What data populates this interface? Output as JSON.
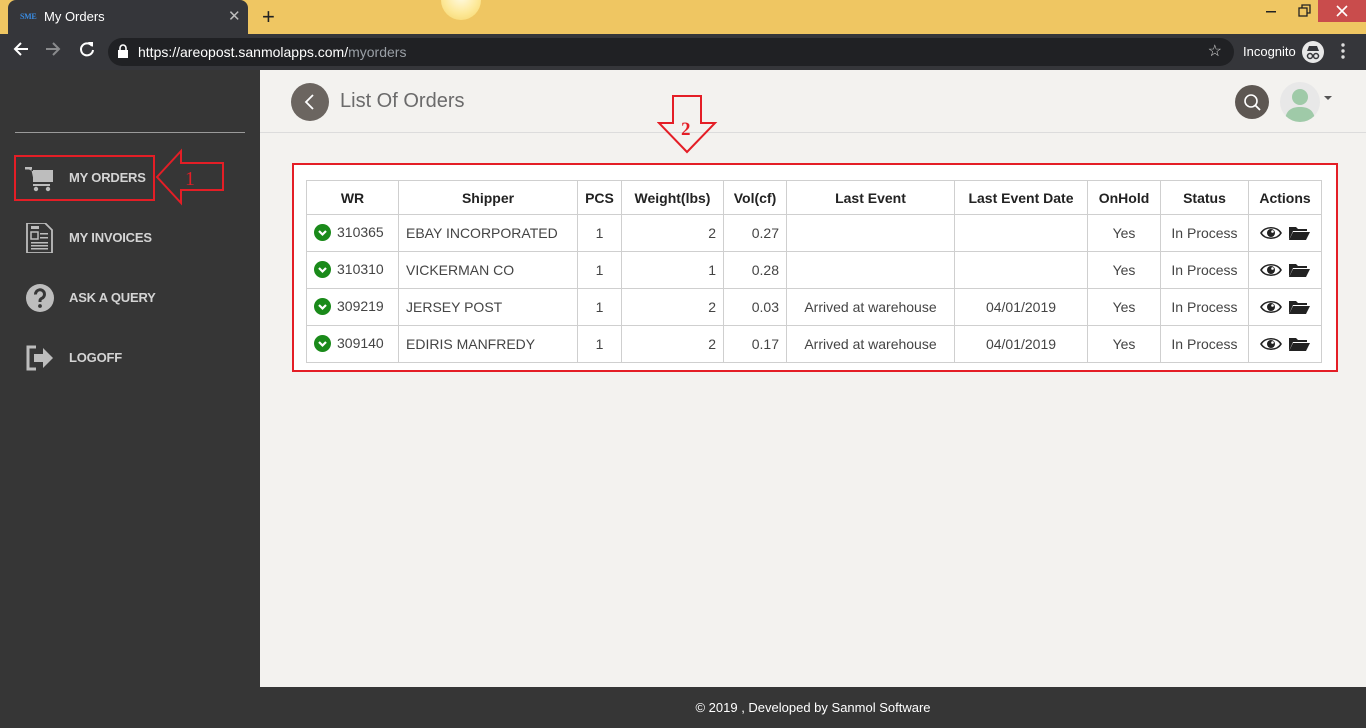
{
  "browser": {
    "tab": {
      "favicon_text": "SME",
      "title": "My Orders"
    },
    "url": {
      "host": "https://areopost.sanmolapps.com/",
      "path": "myorders"
    },
    "incognito_label": "Incognito"
  },
  "sidebar": {
    "items": [
      {
        "label": "MY ORDERS",
        "icon": "cart-icon",
        "active": true
      },
      {
        "label": "MY INVOICES",
        "icon": "invoice-icon"
      },
      {
        "label": "ASK A QUERY",
        "icon": "question-icon"
      },
      {
        "label": "LOGOFF",
        "icon": "logoff-icon"
      }
    ]
  },
  "annotations": {
    "arrow1_label": "1",
    "arrow2_label": "2",
    "color": "#e41e26"
  },
  "header": {
    "title": "List Of Orders"
  },
  "orders": {
    "columns": [
      "WR",
      "Shipper",
      "PCS",
      "Weight(lbs)",
      "Vol(cf)",
      "Last Event",
      "Last Event Date",
      "OnHold",
      "Status",
      "Actions"
    ],
    "rows": [
      {
        "wr": "310365",
        "shipper": "EBAY INCORPORATED",
        "pcs": "1",
        "weight": "2",
        "vol": "0.27",
        "last_event": "",
        "last_event_date": "",
        "onhold": "Yes",
        "status": "In Process"
      },
      {
        "wr": "310310",
        "shipper": "VICKERMAN CO",
        "pcs": "1",
        "weight": "1",
        "vol": "0.28",
        "last_event": "",
        "last_event_date": "",
        "onhold": "Yes",
        "status": "In Process"
      },
      {
        "wr": "309219",
        "shipper": "JERSEY POST",
        "pcs": "1",
        "weight": "2",
        "vol": "0.03",
        "last_event": "Arrived at warehouse",
        "last_event_date": "04/01/2019",
        "onhold": "Yes",
        "status": "In Process"
      },
      {
        "wr": "309140",
        "shipper": "EDIRIS MANFREDY",
        "pcs": "1",
        "weight": "2",
        "vol": "0.17",
        "last_event": "Arrived at warehouse",
        "last_event_date": "04/01/2019",
        "onhold": "Yes",
        "status": "In Process"
      }
    ]
  },
  "footer": {
    "text": "© 2019 , Developed by Sanmol Software"
  }
}
